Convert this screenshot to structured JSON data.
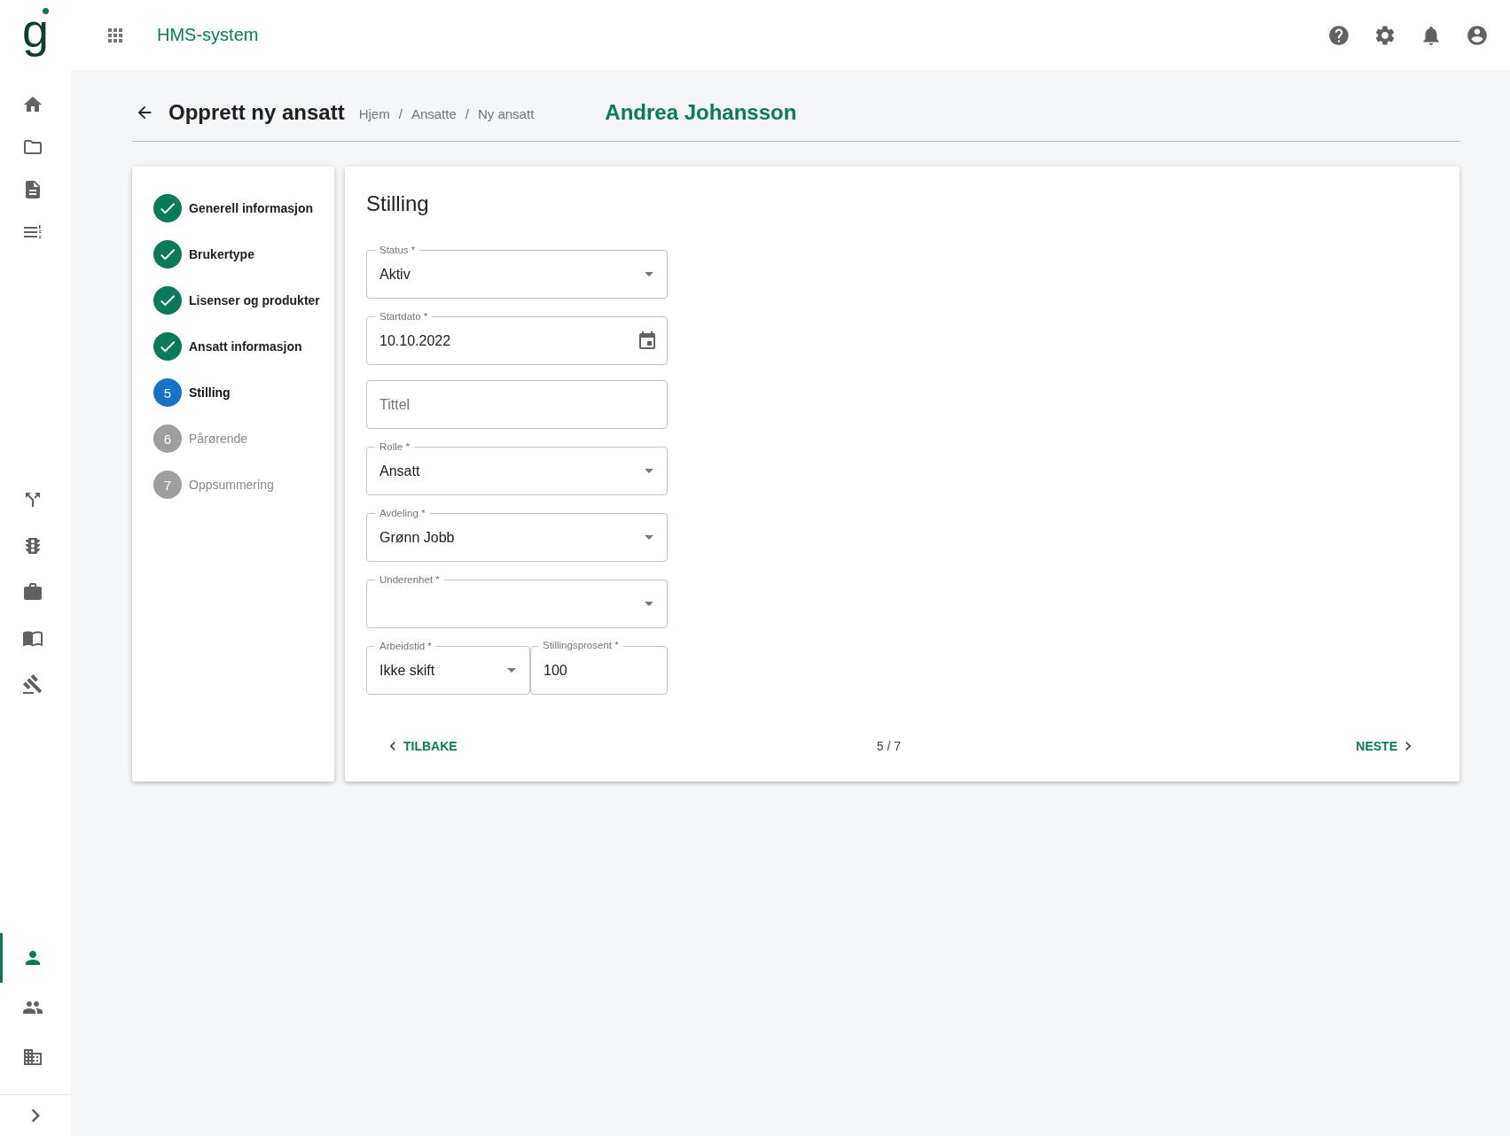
{
  "logo": "g",
  "app_title": "HMS-system",
  "nav_groups": [
    [
      {
        "selected": false
      },
      {
        "selected": false
      },
      {
        "selected": false
      },
      {
        "selected": false
      }
    ],
    [
      {
        "selected": false
      },
      {
        "selected": false
      },
      {
        "selected": false
      },
      {
        "selected": false
      },
      {
        "selected": false
      }
    ],
    [
      {
        "selected": true
      },
      {
        "selected": false
      },
      {
        "selected": false
      }
    ]
  ],
  "page_title": "Opprett ny ansatt",
  "breadcrumb": {
    "separator": "/",
    "items": [
      "Hjem",
      "Ansatte",
      "Ny ansatt"
    ]
  },
  "person_name": "Andrea Johansson",
  "steps": [
    {
      "label": "Generell informasjon",
      "completed": true,
      "selected": false
    },
    {
      "label": "Brukertype",
      "completed": true,
      "selected": false
    },
    {
      "label": "Lisenser og produkter",
      "completed": true,
      "selected": false
    },
    {
      "label": "Ansatt informasjon",
      "completed": true,
      "selected": false
    },
    {
      "label": "Stilling",
      "number": "5",
      "completed": false,
      "selected": true
    },
    {
      "label": "Pårørende",
      "number": "6",
      "completed": false,
      "selected": false
    },
    {
      "label": "Oppsummering",
      "number": "7",
      "completed": false,
      "selected": false
    }
  ],
  "form": {
    "title": "Stilling",
    "rows": [
      [
        {
          "kind": "select",
          "label": "Status *",
          "value": "Aktiv"
        }
      ],
      [
        {
          "kind": "date",
          "label": "Startdato *",
          "value": "10.10.2022"
        }
      ],
      [
        {
          "kind": "text",
          "placeholder": "Tittel"
        }
      ],
      [
        {
          "kind": "select",
          "label": "Rolle *",
          "value": "Ansatt"
        }
      ],
      [
        {
          "kind": "select",
          "label": "Avdeling *",
          "value": "Grønn Jobb"
        }
      ],
      [
        {
          "kind": "select",
          "label": "Underenhet *"
        }
      ],
      [
        {
          "kind": "select",
          "label": "Arbeidstid *",
          "value": "Ikke skift"
        },
        {
          "kind": "text",
          "label": "Stillingsprosent *",
          "value": "100"
        }
      ]
    ]
  },
  "footer": {
    "back": "TILBAKE",
    "progress": "5 / 7",
    "next": "NESTE"
  }
}
